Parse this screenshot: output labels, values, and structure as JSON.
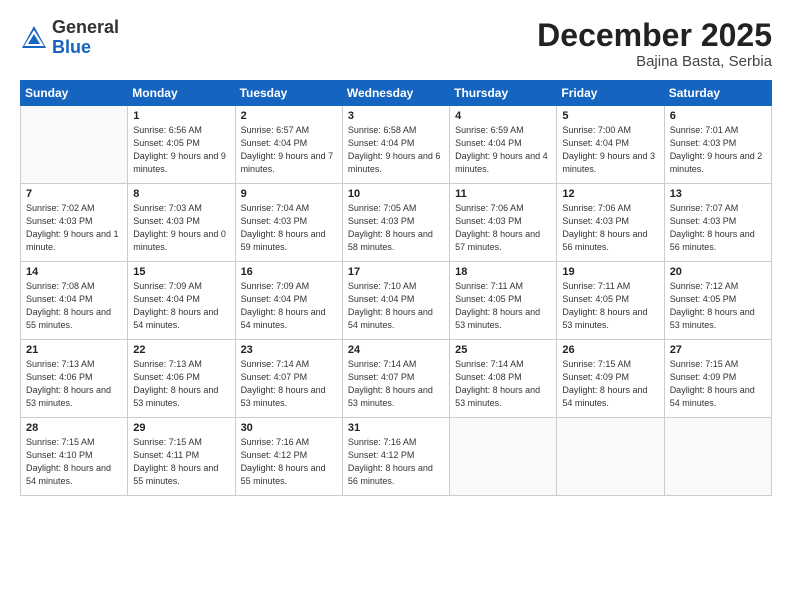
{
  "logo": {
    "general": "General",
    "blue": "Blue"
  },
  "header": {
    "title": "December 2025",
    "location": "Bajina Basta, Serbia"
  },
  "weekdays": [
    "Sunday",
    "Monday",
    "Tuesday",
    "Wednesday",
    "Thursday",
    "Friday",
    "Saturday"
  ],
  "weeks": [
    [
      {
        "day": "",
        "empty": true
      },
      {
        "day": "1",
        "sunrise": "6:56 AM",
        "sunset": "4:05 PM",
        "daylight": "9 hours and 9 minutes."
      },
      {
        "day": "2",
        "sunrise": "6:57 AM",
        "sunset": "4:04 PM",
        "daylight": "9 hours and 7 minutes."
      },
      {
        "day": "3",
        "sunrise": "6:58 AM",
        "sunset": "4:04 PM",
        "daylight": "9 hours and 6 minutes."
      },
      {
        "day": "4",
        "sunrise": "6:59 AM",
        "sunset": "4:04 PM",
        "daylight": "9 hours and 4 minutes."
      },
      {
        "day": "5",
        "sunrise": "7:00 AM",
        "sunset": "4:04 PM",
        "daylight": "9 hours and 3 minutes."
      },
      {
        "day": "6",
        "sunrise": "7:01 AM",
        "sunset": "4:03 PM",
        "daylight": "9 hours and 2 minutes."
      }
    ],
    [
      {
        "day": "7",
        "sunrise": "7:02 AM",
        "sunset": "4:03 PM",
        "daylight": "9 hours and 1 minute."
      },
      {
        "day": "8",
        "sunrise": "7:03 AM",
        "sunset": "4:03 PM",
        "daylight": "9 hours and 0 minutes."
      },
      {
        "day": "9",
        "sunrise": "7:04 AM",
        "sunset": "4:03 PM",
        "daylight": "8 hours and 59 minutes."
      },
      {
        "day": "10",
        "sunrise": "7:05 AM",
        "sunset": "4:03 PM",
        "daylight": "8 hours and 58 minutes."
      },
      {
        "day": "11",
        "sunrise": "7:06 AM",
        "sunset": "4:03 PM",
        "daylight": "8 hours and 57 minutes."
      },
      {
        "day": "12",
        "sunrise": "7:06 AM",
        "sunset": "4:03 PM",
        "daylight": "8 hours and 56 minutes."
      },
      {
        "day": "13",
        "sunrise": "7:07 AM",
        "sunset": "4:03 PM",
        "daylight": "8 hours and 56 minutes."
      }
    ],
    [
      {
        "day": "14",
        "sunrise": "7:08 AM",
        "sunset": "4:04 PM",
        "daylight": "8 hours and 55 minutes."
      },
      {
        "day": "15",
        "sunrise": "7:09 AM",
        "sunset": "4:04 PM",
        "daylight": "8 hours and 54 minutes."
      },
      {
        "day": "16",
        "sunrise": "7:09 AM",
        "sunset": "4:04 PM",
        "daylight": "8 hours and 54 minutes."
      },
      {
        "day": "17",
        "sunrise": "7:10 AM",
        "sunset": "4:04 PM",
        "daylight": "8 hours and 54 minutes."
      },
      {
        "day": "18",
        "sunrise": "7:11 AM",
        "sunset": "4:05 PM",
        "daylight": "8 hours and 53 minutes."
      },
      {
        "day": "19",
        "sunrise": "7:11 AM",
        "sunset": "4:05 PM",
        "daylight": "8 hours and 53 minutes."
      },
      {
        "day": "20",
        "sunrise": "7:12 AM",
        "sunset": "4:05 PM",
        "daylight": "8 hours and 53 minutes."
      }
    ],
    [
      {
        "day": "21",
        "sunrise": "7:13 AM",
        "sunset": "4:06 PM",
        "daylight": "8 hours and 53 minutes."
      },
      {
        "day": "22",
        "sunrise": "7:13 AM",
        "sunset": "4:06 PM",
        "daylight": "8 hours and 53 minutes."
      },
      {
        "day": "23",
        "sunrise": "7:14 AM",
        "sunset": "4:07 PM",
        "daylight": "8 hours and 53 minutes."
      },
      {
        "day": "24",
        "sunrise": "7:14 AM",
        "sunset": "4:07 PM",
        "daylight": "8 hours and 53 minutes."
      },
      {
        "day": "25",
        "sunrise": "7:14 AM",
        "sunset": "4:08 PM",
        "daylight": "8 hours and 53 minutes."
      },
      {
        "day": "26",
        "sunrise": "7:15 AM",
        "sunset": "4:09 PM",
        "daylight": "8 hours and 54 minutes."
      },
      {
        "day": "27",
        "sunrise": "7:15 AM",
        "sunset": "4:09 PM",
        "daylight": "8 hours and 54 minutes."
      }
    ],
    [
      {
        "day": "28",
        "sunrise": "7:15 AM",
        "sunset": "4:10 PM",
        "daylight": "8 hours and 54 minutes."
      },
      {
        "day": "29",
        "sunrise": "7:15 AM",
        "sunset": "4:11 PM",
        "daylight": "8 hours and 55 minutes."
      },
      {
        "day": "30",
        "sunrise": "7:16 AM",
        "sunset": "4:12 PM",
        "daylight": "8 hours and 55 minutes."
      },
      {
        "day": "31",
        "sunrise": "7:16 AM",
        "sunset": "4:12 PM",
        "daylight": "8 hours and 56 minutes."
      },
      {
        "day": "",
        "empty": true
      },
      {
        "day": "",
        "empty": true
      },
      {
        "day": "",
        "empty": true
      }
    ]
  ]
}
